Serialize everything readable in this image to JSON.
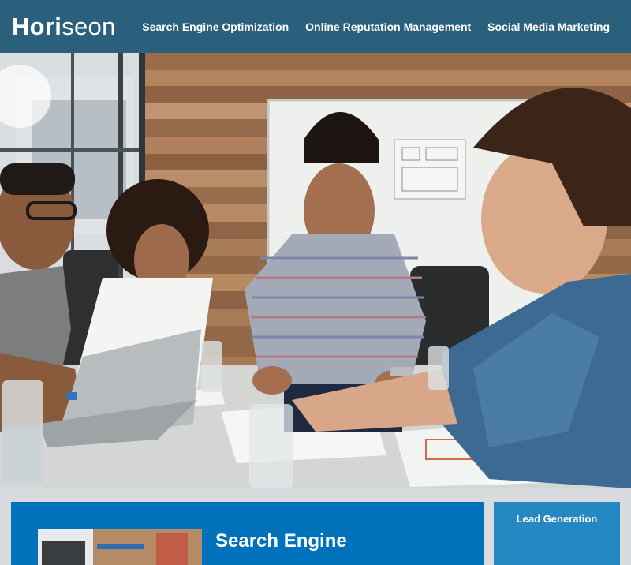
{
  "header": {
    "brand": {
      "text_main": "Hori",
      "text_accent": "seon"
    },
    "nav": [
      {
        "label": "Search Engine Optimization"
      },
      {
        "label": "Online Reputation Management"
      },
      {
        "label": "Social Media Marketing"
      }
    ]
  },
  "hero": {
    "image": "team-meeting-photo"
  },
  "content": {
    "main_card": {
      "title": "Search Engine",
      "image": "workspace-thumbnail"
    },
    "side_card": {
      "title": "Lead Generation"
    }
  },
  "colors": {
    "header_bg": "#2a607c",
    "page_bg": "#d9dcdf",
    "card_main_bg": "#0072bb",
    "card_side_bg": "#2588c2",
    "text": "#ffffff"
  }
}
